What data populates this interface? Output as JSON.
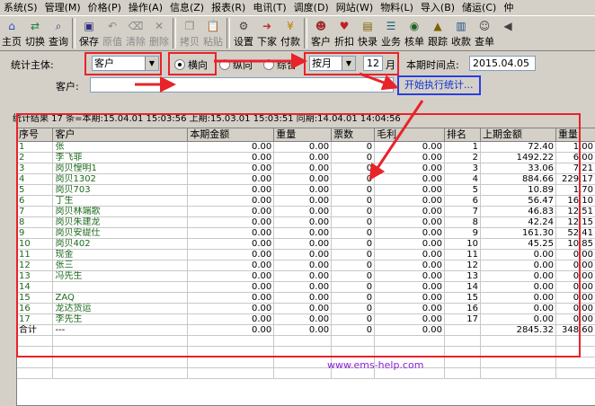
{
  "menu": [
    "系统(S)",
    "管理(M)",
    "价格(P)",
    "操作(A)",
    "信息(Z)",
    "报表(R)",
    "电讯(T)",
    "调度(D)",
    "网站(W)",
    "物料(L)",
    "导入(B)",
    "储运(C)",
    "仲"
  ],
  "toolbar": [
    {
      "label": "主页",
      "icon": "home-icon",
      "glyph": "⌂",
      "color": "#2050c0",
      "disabled": false
    },
    {
      "label": "切换",
      "icon": "switch-icon",
      "glyph": "⇄",
      "color": "#208040",
      "disabled": false
    },
    {
      "label": "查询",
      "icon": "search-icon",
      "glyph": "⌕",
      "color": "#304080",
      "disabled": false
    },
    {
      "sep": true
    },
    {
      "label": "保存",
      "icon": "save-icon",
      "glyph": "▣",
      "color": "#303080",
      "disabled": false
    },
    {
      "label": "原值",
      "icon": "undo-icon",
      "glyph": "↶",
      "color": "#888",
      "disabled": true
    },
    {
      "label": "清除",
      "icon": "clear-icon",
      "glyph": "⌫",
      "color": "#888",
      "disabled": true
    },
    {
      "label": "删除",
      "icon": "delete-icon",
      "glyph": "✕",
      "color": "#888",
      "disabled": true
    },
    {
      "sep": true
    },
    {
      "label": "拷贝",
      "icon": "copy-icon",
      "glyph": "❐",
      "color": "#888",
      "disabled": true
    },
    {
      "label": "粘贴",
      "icon": "paste-icon",
      "glyph": "📋",
      "color": "#888",
      "disabled": true
    },
    {
      "sep": true
    },
    {
      "label": "设置",
      "icon": "settings-icon",
      "glyph": "⚙",
      "color": "#404040",
      "disabled": false
    },
    {
      "label": "下家",
      "icon": "next-client-icon",
      "glyph": "➜",
      "color": "#c03030",
      "disabled": false
    },
    {
      "label": "付款",
      "icon": "payment-icon",
      "glyph": "¥",
      "color": "#c08000",
      "disabled": false
    },
    {
      "sep": true
    },
    {
      "label": "客户",
      "icon": "customer-icon",
      "glyph": "☻",
      "color": "#a03030",
      "disabled": false
    },
    {
      "label": "折扣",
      "icon": "discount-icon",
      "glyph": "♥",
      "color": "#c02020",
      "disabled": false
    },
    {
      "label": "快录",
      "icon": "quick-entry-icon",
      "glyph": "▤",
      "color": "#806000",
      "disabled": false
    },
    {
      "label": "业务",
      "icon": "business-icon",
      "glyph": "☰",
      "color": "#206080",
      "disabled": false
    },
    {
      "label": "核单",
      "icon": "verify-icon",
      "glyph": "◉",
      "color": "#206020",
      "disabled": false
    },
    {
      "label": "跟踪",
      "icon": "track-icon",
      "glyph": "▲",
      "color": "#806000",
      "disabled": false
    },
    {
      "label": "收款",
      "icon": "receive-icon",
      "glyph": "▥",
      "color": "#205080",
      "disabled": false
    },
    {
      "label": "查单",
      "icon": "find-order-icon",
      "glyph": "☺",
      "color": "#404040",
      "disabled": false
    },
    {
      "label": "",
      "icon": "more-icon",
      "glyph": "◀",
      "color": "#404040",
      "disabled": false
    }
  ],
  "form": {
    "subject_label": "统计主体:",
    "subject_value": "客户",
    "radio_horizontal": "横向",
    "radio_vertical": "纵向",
    "radio_combined": "综合",
    "period_value": "按月",
    "period_num": "12",
    "period_unit": "月",
    "time_point_label": "本期时间点:",
    "time_point_value": "2015.04.05",
    "customer_label": "客户:",
    "customer_value": "",
    "exec_button": "开始执行统计..."
  },
  "summary": "统计结果 17 条=本期:15.04.01 15:03:56 上期:15.03.01 15:03:51 同期:14.04.01 14:04:56",
  "columns": [
    "序号",
    "客户",
    "本期金额",
    "重量",
    "票数",
    "毛利",
    "排名",
    "上期金额",
    "重量"
  ],
  "rows": [
    [
      "1",
      "张",
      "0.00",
      "0.00",
      "0",
      "0.00",
      "1",
      "72.40",
      "1.00"
    ],
    [
      "2",
      "李飞菲",
      "0.00",
      "0.00",
      "0",
      "0.00",
      "2",
      "1492.22",
      "6.00"
    ],
    [
      "3",
      "岗贝惶明1",
      "0.00",
      "0.00",
      "0",
      "0.00",
      "3",
      "33.06",
      "7.21"
    ],
    [
      "4",
      "岗贝1302",
      "0.00",
      "0.00",
      "0",
      "0.00",
      "4",
      "884.66",
      "229.17"
    ],
    [
      "5",
      "岗贝703",
      "0.00",
      "0.00",
      "0",
      "0.00",
      "5",
      "10.89",
      "1.70"
    ],
    [
      "6",
      "丁生",
      "0.00",
      "0.00",
      "0",
      "0.00",
      "6",
      "56.47",
      "16.10"
    ],
    [
      "7",
      "岗贝林端歌",
      "0.00",
      "0.00",
      "0",
      "0.00",
      "7",
      "46.83",
      "12.51"
    ],
    [
      "8",
      "岗贝朱建龙",
      "0.00",
      "0.00",
      "0",
      "0.00",
      "8",
      "42.24",
      "12.15"
    ],
    [
      "9",
      "岗贝安缇仕",
      "0.00",
      "0.00",
      "0",
      "0.00",
      "9",
      "161.30",
      "52.41"
    ],
    [
      "10",
      "岗贝402",
      "0.00",
      "0.00",
      "0",
      "0.00",
      "10",
      "45.25",
      "10.85"
    ],
    [
      "11",
      "现金",
      "0.00",
      "0.00",
      "0",
      "0.00",
      "11",
      "0.00",
      "0.00"
    ],
    [
      "12",
      "张三",
      "0.00",
      "0.00",
      "0",
      "0.00",
      "12",
      "0.00",
      "0.00"
    ],
    [
      "13",
      "冯先生",
      "0.00",
      "0.00",
      "0",
      "0.00",
      "13",
      "0.00",
      "0.00"
    ],
    [
      "14",
      "",
      "0.00",
      "0.00",
      "0",
      "0.00",
      "14",
      "0.00",
      "0.00"
    ],
    [
      "15",
      "ZAQ",
      "0.00",
      "0.00",
      "0",
      "0.00",
      "15",
      "0.00",
      "0.00"
    ],
    [
      "16",
      "龙达货运",
      "0.00",
      "0.00",
      "0",
      "0.00",
      "16",
      "0.00",
      "0.00"
    ],
    [
      "17",
      "李先生",
      "0.00",
      "0.00",
      "0",
      "0.00",
      "17",
      "0.00",
      "0.00"
    ]
  ],
  "total_row": [
    "合计",
    "---",
    "0.00",
    "0.00",
    "0",
    "0.00",
    "",
    "2845.32",
    "348.60"
  ],
  "watermark": "www.ems-help.com",
  "colors": {
    "annotation_red": "#e8232a",
    "link_blue": "#1030d0",
    "name_green": "#1c6a1c",
    "watermark_purple": "#8b1fd6"
  }
}
